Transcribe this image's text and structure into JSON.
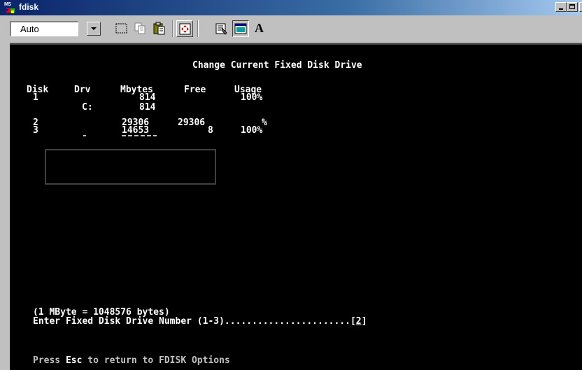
{
  "window": {
    "title": "fdisk",
    "icon_text": "MS",
    "buttons": {
      "minimize": "minimize",
      "maximize": "maximize",
      "close": "×"
    }
  },
  "toolbar": {
    "font_size_value": "Auto",
    "tools": [
      "mark-icon",
      "copy-icon",
      "paste-icon",
      "fullscreen-icon",
      "properties-icon",
      "background-icon",
      "font-icon"
    ],
    "font_tool_label": "A"
  },
  "console": {
    "header": "Change Current Fixed Disk Drive",
    "columns": {
      "disk": "Disk",
      "drv": "Drv",
      "mbytes": "Mbytes",
      "free": "Free",
      "usage": "Usage"
    },
    "rows": [
      {
        "disk": "1",
        "drv": "",
        "mbytes": "814",
        "free": "",
        "usage": "100%"
      },
      {
        "disk": "",
        "drv": "C:",
        "mbytes": "814",
        "free": "",
        "usage": ""
      },
      {
        "disk": "2",
        "drv": "",
        "mbytes": "29306",
        "free": "29306",
        "usage": "%"
      },
      {
        "disk": "3",
        "drv": "",
        "mbytes": "14653",
        "free": "8",
        "usage": "100%"
      }
    ],
    "mbyte_note": "(1 MByte = 1048576 bytes)",
    "prompt": "Enter Fixed Disk Drive Number (1-3).......................",
    "prompt_bracket_open": "[",
    "prompt_value": "2",
    "prompt_bracket_close": "]",
    "footer_pre": "Press ",
    "footer_key": "Esc",
    "footer_post": " to return to FDISK Options"
  },
  "colors": {
    "titlebar_start": "#0a246a",
    "titlebar_end": "#a6caf0",
    "console_bg": "#000000",
    "console_text": "#c0c0c0",
    "console_bright": "#ffffff"
  }
}
